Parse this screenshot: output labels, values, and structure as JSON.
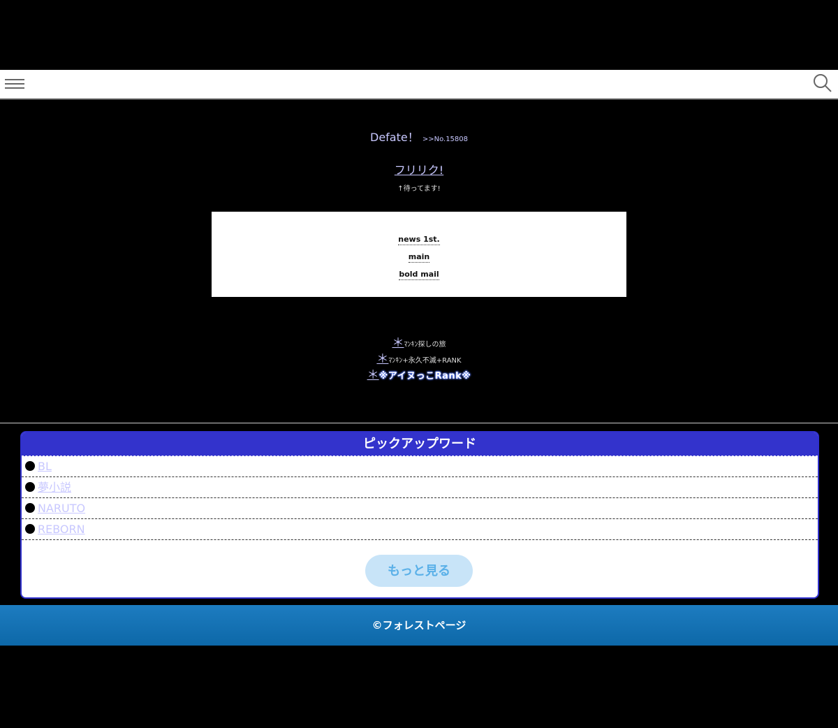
{
  "header": {
    "menu_icon": "hamburger-menu-icon",
    "search_icon": "search-icon"
  },
  "site": {
    "title": "Defate！",
    "number": ">>No.15808"
  },
  "frilink": {
    "label": "フリリク!",
    "note": "↑待ってます!"
  },
  "nav": {
    "items": [
      "news 1st.",
      "main",
      "bold mail"
    ]
  },
  "rank_links": {
    "star": "＊",
    "items": [
      "ﾏﾝｷﾝ探しの旅",
      "ﾏﾝｷﾝ+永久不滅+RANK",
      "※アイヌっこRank※"
    ]
  },
  "pickup": {
    "title": "ピックアップワード",
    "words": [
      "BL",
      "夢小説",
      "NARUTO",
      "REBORN"
    ],
    "more_label": "もっと見る"
  },
  "footer": {
    "copyright": "©フォレストページ"
  },
  "colors": {
    "background": "#000000",
    "link": "#c8c8ff",
    "pickup_header": "#3333cc",
    "footer": "#1372b4"
  }
}
